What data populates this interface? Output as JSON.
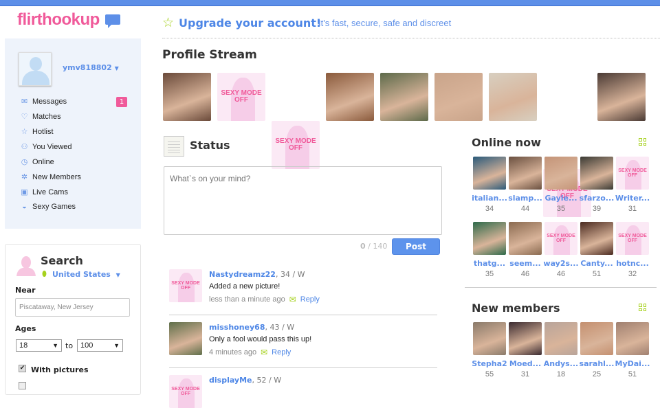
{
  "brand": {
    "logo": "flirthookup",
    "top_bar_color": "#5d8fe8",
    "accent_pink": "#f05a9a",
    "accent_green": "#a6d11d"
  },
  "upgrade": {
    "icon": "star-outline-icon",
    "title": "Upgrade your account!",
    "subtitle": "It's fast, secure, safe and discreet"
  },
  "user": {
    "username": "ymv818802"
  },
  "sidebar": {
    "items": [
      {
        "label": "Messages",
        "icon": "envelope-icon",
        "badge": "1"
      },
      {
        "label": "Matches",
        "icon": "heart-icon"
      },
      {
        "label": "Hotlist",
        "icon": "star-icon"
      },
      {
        "label": "You Viewed",
        "icon": "person-icon"
      },
      {
        "label": "Online",
        "icon": "clock-icon"
      },
      {
        "label": "New Members",
        "icon": "gear-icon"
      },
      {
        "label": "Live Cams",
        "icon": "camera-icon"
      },
      {
        "label": "Sexy Games",
        "icon": "lips-icon"
      }
    ]
  },
  "search": {
    "title": "Search",
    "country": "United States",
    "near_label": "Near",
    "near_placeholder": "Piscataway, New Jersey",
    "ages_label": "Ages",
    "age_from": "18",
    "age_to": "100",
    "to_label": "to",
    "with_pictures_label": "With pictures",
    "with_pictures_checked": true
  },
  "sexy_mode_off": "SEXY MODE OFF",
  "profile_stream": {
    "title": "Profile Stream",
    "photos": [
      {
        "type": "photo",
        "color": "#6a4a3a"
      },
      {
        "type": "sexy-off"
      },
      {
        "type": "sexy-off"
      },
      {
        "type": "photo",
        "color": "#8a5a3c"
      },
      {
        "type": "photo",
        "color": "#5d6a4a"
      },
      {
        "type": "photo",
        "color": "#c9a48a"
      },
      {
        "type": "photo",
        "color": "#d8cfc0"
      },
      {
        "type": "sexy-off"
      },
      {
        "type": "photo",
        "color": "#4a3a34"
      }
    ]
  },
  "status": {
    "title": "Status",
    "placeholder": "What`s on your mind?",
    "count": "0",
    "max": "/ 140",
    "post_label": "Post"
  },
  "feed": [
    {
      "name": "Nastydreamz22",
      "meta": ", 34 / W",
      "text": "Added a new picture!",
      "time": "less than a minute ago",
      "reply": "Reply",
      "type": "sexy-off"
    },
    {
      "name": "misshoney68",
      "meta": ", 43 / W",
      "text": "Only a fool would pass this up!",
      "time": "4 minutes ago",
      "reply": "Reply",
      "type": "photo",
      "color": "#5f6f4a"
    },
    {
      "name": "displayMe",
      "meta": ", 52 / W",
      "type": "sexy-off"
    }
  ],
  "online_now": {
    "title": "Online now",
    "members": [
      {
        "name": "italian...",
        "age": "34",
        "type": "photo",
        "color": "#2a5a7a"
      },
      {
        "name": "slamp...",
        "age": "44",
        "type": "photo",
        "color": "#6a5040"
      },
      {
        "name": "Gayle...",
        "age": "35",
        "type": "photo",
        "color": "#c49478"
      },
      {
        "name": "sfarzo...",
        "age": "39",
        "type": "photo",
        "color": "#3a3a34"
      },
      {
        "name": "Writer...",
        "age": "31",
        "type": "sexy-off"
      },
      {
        "name": "thatg...",
        "age": "35",
        "type": "photo",
        "color": "#2e6a4a"
      },
      {
        "name": "seem...",
        "age": "46",
        "type": "photo",
        "color": "#8a6a50"
      },
      {
        "name": "way2s...",
        "age": "46",
        "type": "sexy-off"
      },
      {
        "name": "Canty...",
        "age": "51",
        "type": "photo",
        "color": "#4a2a20"
      },
      {
        "name": "hotnc...",
        "age": "32",
        "type": "sexy-off"
      }
    ]
  },
  "new_members": {
    "title": "New members",
    "members": [
      {
        "name": "Stepha2",
        "age": "55",
        "type": "photo",
        "color": "#8a7a6a"
      },
      {
        "name": "Moed...",
        "age": "31",
        "type": "photo",
        "color": "#3a2a30"
      },
      {
        "name": "Andys...",
        "age": "18",
        "type": "photo",
        "color": "#b8a49a"
      },
      {
        "name": "sarahl...",
        "age": "25",
        "type": "photo",
        "color": "#c49070"
      },
      {
        "name": "MyDai...",
        "age": "51",
        "type": "photo",
        "color": "#a08070"
      }
    ]
  }
}
